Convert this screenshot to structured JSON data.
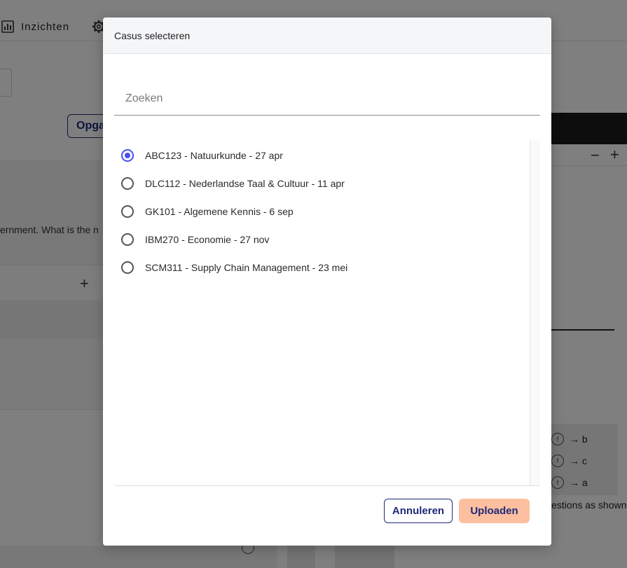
{
  "background": {
    "nav_insights_label": "Inzichten",
    "opga_button_label": "Opga",
    "question_text_fragment": "ernment. What is the n",
    "questions_text_fragment": "estions as shown",
    "mapping_rows": [
      {
        "circle": "f",
        "target": "→ b"
      },
      {
        "circle": "f",
        "target": "→ c"
      },
      {
        "circle": "f",
        "target": "→ a"
      }
    ]
  },
  "modal": {
    "title": "Casus selecteren",
    "search": {
      "placeholder": "Zoeken",
      "value": ""
    },
    "cases": [
      {
        "label": "ABC123 - Natuurkunde - 27 apr",
        "selected": true
      },
      {
        "label": "DLC112 - Nederlandse Taal & Cultuur - 11 apr",
        "selected": false
      },
      {
        "label": "GK101 - Algemene Kennis - 6 sep",
        "selected": false
      },
      {
        "label": "IBM270 - Economie - 27 nov",
        "selected": false
      },
      {
        "label": "SCM311 - Supply Chain Management - 23 mei",
        "selected": false
      }
    ],
    "cancel_label": "Annuleren",
    "upload_label": "Uploaden"
  },
  "colors": {
    "accent": "#4a4ff0",
    "primary_text": "#1e2a78",
    "upload_bg": "#fcbf9f",
    "overlay": "rgba(0,0,0,0.5)"
  },
  "icons": {
    "insights": "bar-chart-icon",
    "settings": "gear-icon",
    "add": "plus-icon",
    "remove": "minus-icon"
  }
}
